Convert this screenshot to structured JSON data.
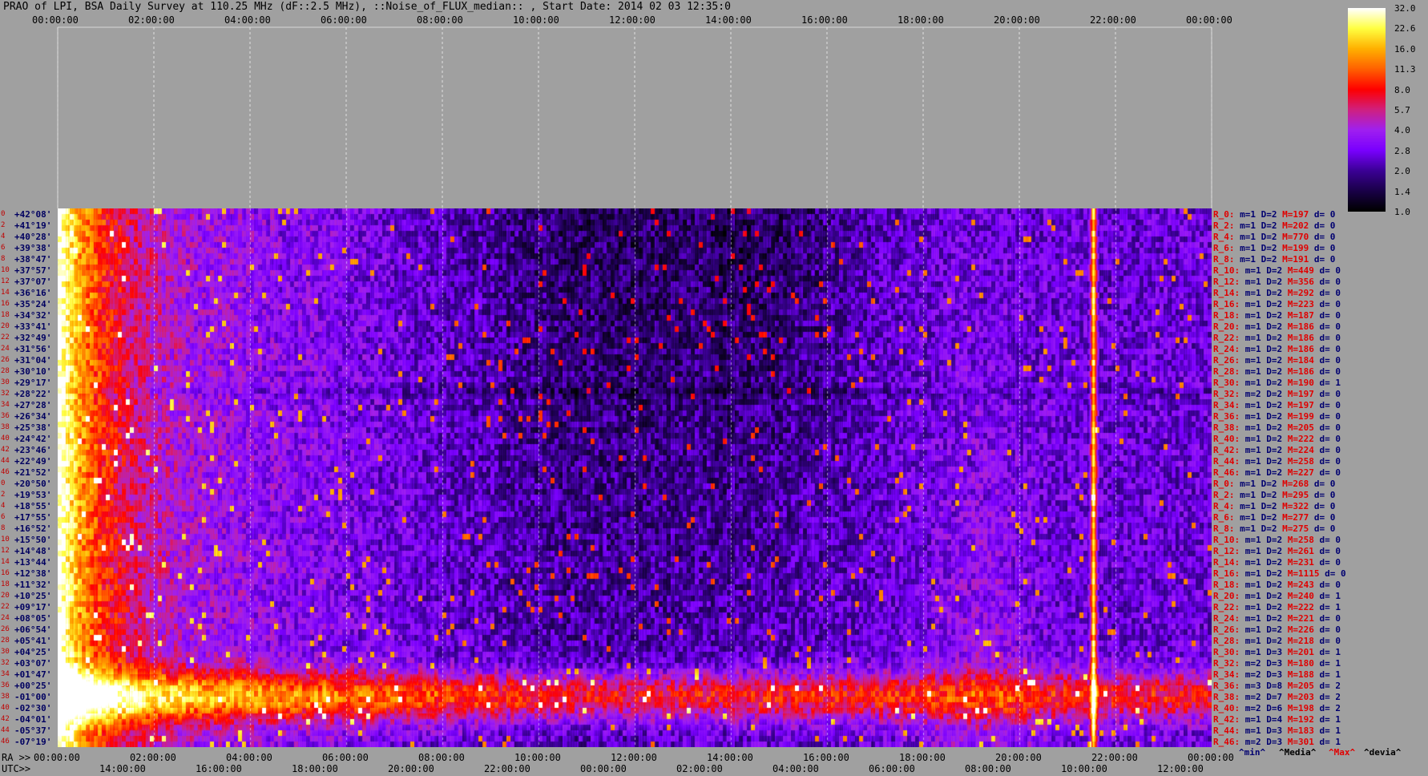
{
  "chart_data": {
    "type": "heatmap",
    "title": "PRAO of LPI, BSA Daily Survey at 110.25 MHz (dF::2.5 MHz), ::Noise_of_FLUX_median:: , Start Date: 2014 02 03 12:35:0",
    "top_ticks": [
      "00:00:00",
      "02:00:00",
      "04:00:00",
      "06:00:00",
      "08:00:00",
      "10:00:00",
      "12:00:00",
      "14:00:00",
      "16:00:00",
      "18:00:00",
      "20:00:00",
      "22:00:00",
      "00:00:00"
    ],
    "x_axis_label": "RA >>",
    "ra_ticks": [
      "00:00:00",
      "02:00:00",
      "04:00:00",
      "06:00:00",
      "08:00:00",
      "10:00:00",
      "12:00:00",
      "14:00:00",
      "16:00:00",
      "18:00:00",
      "20:00:00",
      "22:00:00",
      "00:00:00"
    ],
    "utc_axis_label": "UTC>>",
    "utc_ticks": [
      "14:00:00",
      "16:00:00",
      "18:00:00",
      "20:00:00",
      "22:00:00",
      "00:00:00",
      "02:00:00",
      "04:00:00",
      "06:00:00",
      "08:00:00",
      "10:00:00",
      "12:00:00"
    ],
    "declinations": [
      "+42°08'",
      "+41°19'",
      "+40°28'",
      "+39°38'",
      "+38°47'",
      "+37°57'",
      "+37°07'",
      "+36°16'",
      "+35°24'",
      "+34°32'",
      "+33°41'",
      "+32°49'",
      "+31°56'",
      "+31°04'",
      "+30°10'",
      "+29°17'",
      "+28°22'",
      "+27°28'",
      "+26°34'",
      "+25°38'",
      "+24°42'",
      "+23°46'",
      "+22°49'",
      "+21°52'",
      "+20°50'",
      "+19°53'",
      "+18°55'",
      "+17°55'",
      "+16°52'",
      "+15°50'",
      "+14°48'",
      "+13°44'",
      "+12°38'",
      "+11°32'",
      "+10°25'",
      "+09°17'",
      "+08°05'",
      "+06°54'",
      "+05°41'",
      "+04°25'",
      "+03°07'",
      "+01°47'",
      "+00°25'",
      "-01°00'",
      "-02°30'",
      "-04°01'",
      "-05°37'",
      "-07°19'"
    ],
    "beam_index": [
      "0",
      "2",
      "4",
      "6",
      "8",
      "10",
      "12",
      "14",
      "16",
      "18",
      "20",
      "22",
      "24",
      "26",
      "28",
      "30",
      "32",
      "34",
      "36",
      "38",
      "40",
      "42",
      "44",
      "46",
      "0",
      "2",
      "4",
      "6",
      "8",
      "10",
      "12",
      "14",
      "16",
      "18",
      "20",
      "22",
      "24",
      "26",
      "28",
      "30",
      "32",
      "34",
      "36",
      "38",
      "40",
      "42",
      "44",
      "46"
    ],
    "stats": [
      {
        "name": "R_0:",
        "min": "m=1",
        "med": "D=2",
        "max": "M=197",
        "dev": "d= 0"
      },
      {
        "name": "R_2:",
        "min": "m=1",
        "med": "D=2",
        "max": "M=202",
        "dev": "d= 0"
      },
      {
        "name": "R_4:",
        "min": "m=1",
        "med": "D=2",
        "max": "M=770",
        "dev": "d= 0"
      },
      {
        "name": "R_6:",
        "min": "m=1",
        "med": "D=2",
        "max": "M=199",
        "dev": "d= 0"
      },
      {
        "name": "R_8:",
        "min": "m=1",
        "med": "D=2",
        "max": "M=191",
        "dev": "d= 0"
      },
      {
        "name": "R_10:",
        "min": "m=1",
        "med": "D=2",
        "max": "M=449",
        "dev": "d= 0"
      },
      {
        "name": "R_12:",
        "min": "m=1",
        "med": "D=2",
        "max": "M=356",
        "dev": "d= 0"
      },
      {
        "name": "R_14:",
        "min": "m=1",
        "med": "D=2",
        "max": "M=292",
        "dev": "d= 0"
      },
      {
        "name": "R_16:",
        "min": "m=1",
        "med": "D=2",
        "max": "M=223",
        "dev": "d= 0"
      },
      {
        "name": "R_18:",
        "min": "m=1",
        "med": "D=2",
        "max": "M=187",
        "dev": "d= 0"
      },
      {
        "name": "R_20:",
        "min": "m=1",
        "med": "D=2",
        "max": "M=186",
        "dev": "d= 0"
      },
      {
        "name": "R_22:",
        "min": "m=1",
        "med": "D=2",
        "max": "M=186",
        "dev": "d= 0"
      },
      {
        "name": "R_24:",
        "min": "m=1",
        "med": "D=2",
        "max": "M=186",
        "dev": "d= 0"
      },
      {
        "name": "R_26:",
        "min": "m=1",
        "med": "D=2",
        "max": "M=184",
        "dev": "d= 0"
      },
      {
        "name": "R_28:",
        "min": "m=1",
        "med": "D=2",
        "max": "M=186",
        "dev": "d= 0"
      },
      {
        "name": "R_30:",
        "min": "m=1",
        "med": "D=2",
        "max": "M=190",
        "dev": "d= 1"
      },
      {
        "name": "R_32:",
        "min": "m=2",
        "med": "D=2",
        "max": "M=197",
        "dev": "d= 0"
      },
      {
        "name": "R_34:",
        "min": "m=1",
        "med": "D=2",
        "max": "M=197",
        "dev": "d= 0"
      },
      {
        "name": "R_36:",
        "min": "m=1",
        "med": "D=2",
        "max": "M=199",
        "dev": "d= 0"
      },
      {
        "name": "R_38:",
        "min": "m=1",
        "med": "D=2",
        "max": "M=205",
        "dev": "d= 0"
      },
      {
        "name": "R_40:",
        "min": "m=1",
        "med": "D=2",
        "max": "M=222",
        "dev": "d= 0"
      },
      {
        "name": "R_42:",
        "min": "m=1",
        "med": "D=2",
        "max": "M=224",
        "dev": "d= 0"
      },
      {
        "name": "R_44:",
        "min": "m=1",
        "med": "D=2",
        "max": "M=258",
        "dev": "d= 0"
      },
      {
        "name": "R_46:",
        "min": "m=1",
        "med": "D=2",
        "max": "M=227",
        "dev": "d= 0"
      },
      {
        "name": "R_0:",
        "min": "m=1",
        "med": "D=2",
        "max": "M=268",
        "dev": "d= 0"
      },
      {
        "name": "R_2:",
        "min": "m=1",
        "med": "D=2",
        "max": "M=295",
        "dev": "d= 0"
      },
      {
        "name": "R_4:",
        "min": "m=1",
        "med": "D=2",
        "max": "M=322",
        "dev": "d= 0"
      },
      {
        "name": "R_6:",
        "min": "m=1",
        "med": "D=2",
        "max": "M=277",
        "dev": "d= 0"
      },
      {
        "name": "R_8:",
        "min": "m=1",
        "med": "D=2",
        "max": "M=275",
        "dev": "d= 0"
      },
      {
        "name": "R_10:",
        "min": "m=1",
        "med": "D=2",
        "max": "M=258",
        "dev": "d= 0"
      },
      {
        "name": "R_12:",
        "min": "m=1",
        "med": "D=2",
        "max": "M=261",
        "dev": "d= 0"
      },
      {
        "name": "R_14:",
        "min": "m=1",
        "med": "D=2",
        "max": "M=231",
        "dev": "d= 0"
      },
      {
        "name": "R_16:",
        "min": "m=1",
        "med": "D=2",
        "max": "M=1115",
        "dev": "d= 0"
      },
      {
        "name": "R_18:",
        "min": "m=1",
        "med": "D=2",
        "max": "M=243",
        "dev": "d= 0"
      },
      {
        "name": "R_20:",
        "min": "m=1",
        "med": "D=2",
        "max": "M=240",
        "dev": "d= 1"
      },
      {
        "name": "R_22:",
        "min": "m=1",
        "med": "D=2",
        "max": "M=222",
        "dev": "d= 1"
      },
      {
        "name": "R_24:",
        "min": "m=1",
        "med": "D=2",
        "max": "M=221",
        "dev": "d= 0"
      },
      {
        "name": "R_26:",
        "min": "m=1",
        "med": "D=2",
        "max": "M=226",
        "dev": "d= 0"
      },
      {
        "name": "R_28:",
        "min": "m=1",
        "med": "D=2",
        "max": "M=218",
        "dev": "d= 0"
      },
      {
        "name": "R_30:",
        "min": "m=1",
        "med": "D=3",
        "max": "M=201",
        "dev": "d= 1"
      },
      {
        "name": "R_32:",
        "min": "m=2",
        "med": "D=3",
        "max": "M=180",
        "dev": "d= 1"
      },
      {
        "name": "R_34:",
        "min": "m=2",
        "med": "D=3",
        "max": "M=188",
        "dev": "d= 1"
      },
      {
        "name": "R_36:",
        "min": "m=3",
        "med": "D=8",
        "max": "M=205",
        "dev": "d= 2"
      },
      {
        "name": "R_38:",
        "min": "m=2",
        "med": "D=7",
        "max": "M=203",
        "dev": "d= 2"
      },
      {
        "name": "R_40:",
        "min": "m=2",
        "med": "D=6",
        "max": "M=198",
        "dev": "d= 2"
      },
      {
        "name": "R_42:",
        "min": "m=1",
        "med": "D=4",
        "max": "M=192",
        "dev": "d= 1"
      },
      {
        "name": "R_44:",
        "min": "m=1",
        "med": "D=3",
        "max": "M=183",
        "dev": "d= 1"
      },
      {
        "name": "R_46:",
        "min": "m=2",
        "med": "D=3",
        "max": "M=301",
        "dev": "d= 1"
      }
    ],
    "stats_legend": {
      "min": "^min^",
      "med": "^Media^",
      "max": "^Max^",
      "dev": "^devia^"
    },
    "colorbar_ticks": [
      "32.0",
      "22.6",
      "16.0",
      "11.3",
      "8.0",
      "5.7",
      "4.0",
      "2.8",
      "2.0",
      "1.4",
      "1.0"
    ],
    "colorbar_range": [
      1.0,
      32.0
    ],
    "colorbar_scale": "log",
    "colormap": [
      "#000000",
      "#1a0048",
      "#3c0096",
      "#7a00ff",
      "#a020f0",
      "#d02080",
      "#ff0000",
      "#ff6000",
      "#ffb000",
      "#ffff40",
      "#ffffff"
    ],
    "grid": true
  }
}
